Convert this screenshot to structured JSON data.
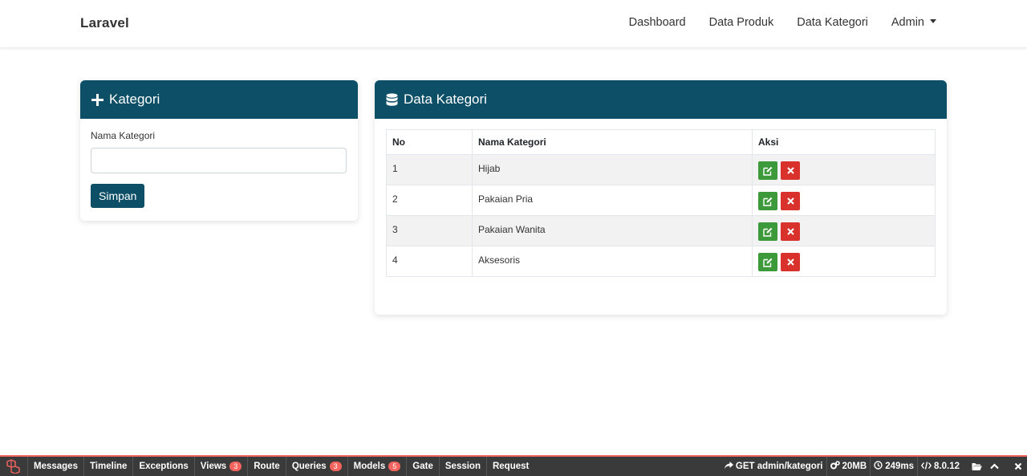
{
  "navbar": {
    "brand": "Laravel",
    "links": [
      "Dashboard",
      "Data Produk",
      "Data Kategori",
      "Admin"
    ]
  },
  "form_card": {
    "title": "Kategori",
    "label": "Nama Kategori",
    "input_value": "",
    "submit_label": "Simpan"
  },
  "table_card": {
    "title": "Data Kategori",
    "headers": [
      "No",
      "Nama Kategori",
      "Aksi"
    ],
    "rows": [
      {
        "no": "1",
        "name": "Hijab"
      },
      {
        "no": "2",
        "name": "Pakaian Pria"
      },
      {
        "no": "3",
        "name": "Pakaian Wanita"
      },
      {
        "no": "4",
        "name": "Aksesoris"
      }
    ]
  },
  "debugbar": {
    "tabs": [
      {
        "label": "Messages"
      },
      {
        "label": "Timeline"
      },
      {
        "label": "Exceptions"
      },
      {
        "label": "Views",
        "badge": "3"
      },
      {
        "label": "Route"
      },
      {
        "label": "Queries",
        "badge": "3"
      },
      {
        "label": "Models",
        "badge": "5"
      },
      {
        "label": "Gate"
      },
      {
        "label": "Session"
      },
      {
        "label": "Request"
      }
    ],
    "route": "GET admin/kategori",
    "memory": "20MB",
    "time": "249ms",
    "php_version": "8.0.12"
  },
  "colors": {
    "primary": "#0c4f66",
    "edit": "#3d9a3a",
    "delete": "#d9312b",
    "debug_accent": "#f4645f"
  }
}
